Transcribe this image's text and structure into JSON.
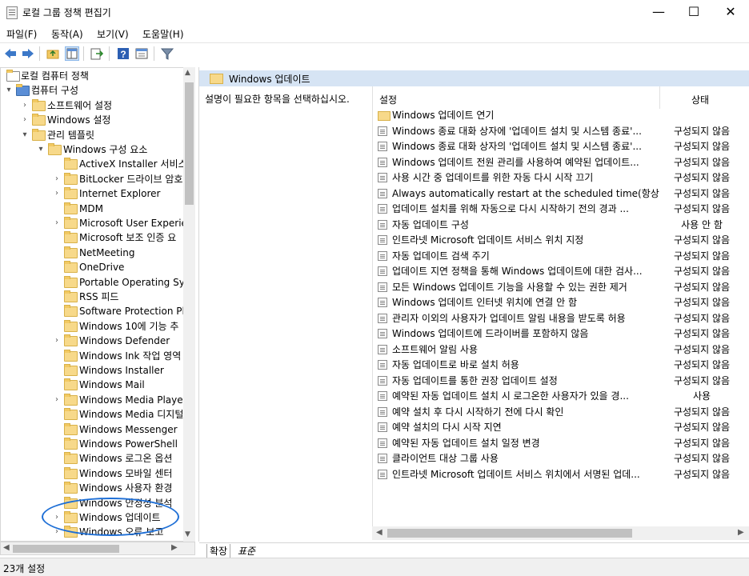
{
  "window": {
    "title": "로컬 그룹 정책 편집기",
    "minimize": "—",
    "maximize": "☐",
    "close": "✕"
  },
  "menu": [
    "파일(F)",
    "동작(A)",
    "보기(V)",
    "도움말(H)"
  ],
  "tree": [
    {
      "label": "로컬 컴퓨터 정책",
      "level": 0,
      "exp": "",
      "kind": "doc"
    },
    {
      "label": "컴퓨터 구성",
      "level": 0,
      "exp": "▾",
      "kind": "pc"
    },
    {
      "label": "소프트웨어 설정",
      "level": 1,
      "exp": "›",
      "kind": "folder"
    },
    {
      "label": "Windows 설정",
      "level": 1,
      "exp": "›",
      "kind": "folder"
    },
    {
      "label": "관리 템플릿",
      "level": 1,
      "exp": "▾",
      "kind": "folder"
    },
    {
      "label": "Windows 구성 요소",
      "level": 2,
      "exp": "▾",
      "kind": "folder"
    },
    {
      "label": "ActiveX Installer 서비스",
      "level": 3,
      "exp": "",
      "kind": "folder"
    },
    {
      "label": "BitLocker 드라이브 암호",
      "level": 3,
      "exp": "›",
      "kind": "folder"
    },
    {
      "label": "Internet Explorer",
      "level": 3,
      "exp": "›",
      "kind": "folder"
    },
    {
      "label": "MDM",
      "level": 3,
      "exp": "",
      "kind": "folder"
    },
    {
      "label": "Microsoft User Experie",
      "level": 3,
      "exp": "›",
      "kind": "folder"
    },
    {
      "label": "Microsoft 보조 인증 요",
      "level": 3,
      "exp": "",
      "kind": "folder"
    },
    {
      "label": "NetMeeting",
      "level": 3,
      "exp": "",
      "kind": "folder"
    },
    {
      "label": "OneDrive",
      "level": 3,
      "exp": "",
      "kind": "folder"
    },
    {
      "label": "Portable Operating Sys",
      "level": 3,
      "exp": "",
      "kind": "folder"
    },
    {
      "label": "RSS 피드",
      "level": 3,
      "exp": "",
      "kind": "folder"
    },
    {
      "label": "Software Protection Pl",
      "level": 3,
      "exp": "",
      "kind": "folder"
    },
    {
      "label": "Windows 10에 기능 추",
      "level": 3,
      "exp": "",
      "kind": "folder"
    },
    {
      "label": "Windows Defender",
      "level": 3,
      "exp": "›",
      "kind": "folder"
    },
    {
      "label": "Windows Ink 작업 영역",
      "level": 3,
      "exp": "",
      "kind": "folder"
    },
    {
      "label": "Windows Installer",
      "level": 3,
      "exp": "",
      "kind": "folder"
    },
    {
      "label": "Windows Mail",
      "level": 3,
      "exp": "",
      "kind": "folder"
    },
    {
      "label": "Windows Media Player",
      "level": 3,
      "exp": "›",
      "kind": "folder"
    },
    {
      "label": "Windows Media 디지털",
      "level": 3,
      "exp": "",
      "kind": "folder"
    },
    {
      "label": "Windows Messenger",
      "level": 3,
      "exp": "",
      "kind": "folder"
    },
    {
      "label": "Windows PowerShell",
      "level": 3,
      "exp": "",
      "kind": "folder"
    },
    {
      "label": "Windows 로그온 옵션",
      "level": 3,
      "exp": "",
      "kind": "folder"
    },
    {
      "label": "Windows 모바일 센터",
      "level": 3,
      "exp": "",
      "kind": "folder"
    },
    {
      "label": "Windows 사용자 환경",
      "level": 3,
      "exp": "",
      "kind": "folder"
    },
    {
      "label": "Windows 안정성 분석",
      "level": 3,
      "exp": "",
      "kind": "folder"
    },
    {
      "label": "Windows 업데이트",
      "level": 3,
      "exp": "›",
      "kind": "folder"
    },
    {
      "label": "Windows 오류 보고",
      "level": 3,
      "exp": "›",
      "kind": "folder"
    }
  ],
  "right": {
    "header_title": "Windows 업데이트",
    "description": "설명이 필요한 항목을 선택하십시오.",
    "col_setting": "설정",
    "col_state": "상태",
    "rows": [
      {
        "name": "Windows 업데이트 연기",
        "state": "",
        "kind": "folder"
      },
      {
        "name": "Windows 종료 대화 상자에 '업데이트 설치 및 시스템 종료'...",
        "state": "구성되지 않음",
        "kind": "setting"
      },
      {
        "name": "Windows 종료 대화 상자의 '업데이트 설치 및 시스템 종료'...",
        "state": "구성되지 않음",
        "kind": "setting"
      },
      {
        "name": "Windows 업데이트 전원 관리를 사용하여 예약된 업데이트...",
        "state": "구성되지 않음",
        "kind": "setting"
      },
      {
        "name": "사용 시간 중 업데이트를 위한 자동 다시 시작 끄기",
        "state": "구성되지 않음",
        "kind": "setting"
      },
      {
        "name": "Always automatically restart at the scheduled time(항상 예...",
        "state": "구성되지 않음",
        "kind": "setting"
      },
      {
        "name": "업데이트 설치를 위해 자동으로 다시 시작하기 전의 경과 ...",
        "state": "구성되지 않음",
        "kind": "setting"
      },
      {
        "name": "자동 업데이트 구성",
        "state": "사용 안 함",
        "kind": "setting"
      },
      {
        "name": "인트라넷 Microsoft 업데이트 서비스 위치 지정",
        "state": "구성되지 않음",
        "kind": "setting"
      },
      {
        "name": "자동 업데이트 검색 주기",
        "state": "구성되지 않음",
        "kind": "setting"
      },
      {
        "name": "업데이트 지연 정책을 통해 Windows 업데이트에 대한 검사...",
        "state": "구성되지 않음",
        "kind": "setting"
      },
      {
        "name": "모든 Windows 업데이트 기능을 사용할 수 있는 권한 제거",
        "state": "구성되지 않음",
        "kind": "setting"
      },
      {
        "name": "Windows 업데이트 인터넷 위치에 연결 안 함",
        "state": "구성되지 않음",
        "kind": "setting"
      },
      {
        "name": "관리자 이외의 사용자가 업데이트 알림 내용을 받도록 허용",
        "state": "구성되지 않음",
        "kind": "setting"
      },
      {
        "name": "Windows 업데이트에 드라이버를 포함하지 않음",
        "state": "구성되지 않음",
        "kind": "setting"
      },
      {
        "name": "소프트웨어 알림 사용",
        "state": "구성되지 않음",
        "kind": "setting"
      },
      {
        "name": "자동 업데이트로 바로 설치 허용",
        "state": "구성되지 않음",
        "kind": "setting"
      },
      {
        "name": "자동 업데이트를 통한 권장 업데이트 설정",
        "state": "구성되지 않음",
        "kind": "setting"
      },
      {
        "name": "예약된 자동 업데이트 설치 시 로그온한 사용자가 있을 경...",
        "state": "사용",
        "kind": "setting"
      },
      {
        "name": "예약 설치 후 다시 시작하기 전에 다시 확인",
        "state": "구성되지 않음",
        "kind": "setting"
      },
      {
        "name": "예약 설치의 다시 시작 지연",
        "state": "구성되지 않음",
        "kind": "setting"
      },
      {
        "name": "예약된 자동 업데이트 설치 일정 변경",
        "state": "구성되지 않음",
        "kind": "setting"
      },
      {
        "name": "클라이언트 대상 그룹 사용",
        "state": "구성되지 않음",
        "kind": "setting"
      },
      {
        "name": "인트라넷 Microsoft 업데이트 서비스 위치에서 서명된 업데...",
        "state": "구성되지 않음",
        "kind": "setting"
      }
    ]
  },
  "tabs": [
    "확장",
    "표준"
  ],
  "status": "23개 설정"
}
